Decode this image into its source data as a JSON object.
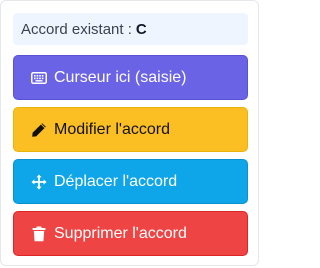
{
  "status": {
    "prefix": "Accord existant :",
    "chord": "C"
  },
  "actions": [
    {
      "label": "Curseur ici (saisie)",
      "icon": "keyboard-icon",
      "color": "#6b63e6"
    },
    {
      "label": "Modifier l'accord",
      "icon": "pencil-icon",
      "color": "#fbbf24"
    },
    {
      "label": "Déplacer l'accord",
      "icon": "move-arrows-icon",
      "color": "#0ea5e9"
    },
    {
      "label": "Supprimer l'accord",
      "icon": "trash-icon",
      "color": "#ef4444"
    }
  ]
}
